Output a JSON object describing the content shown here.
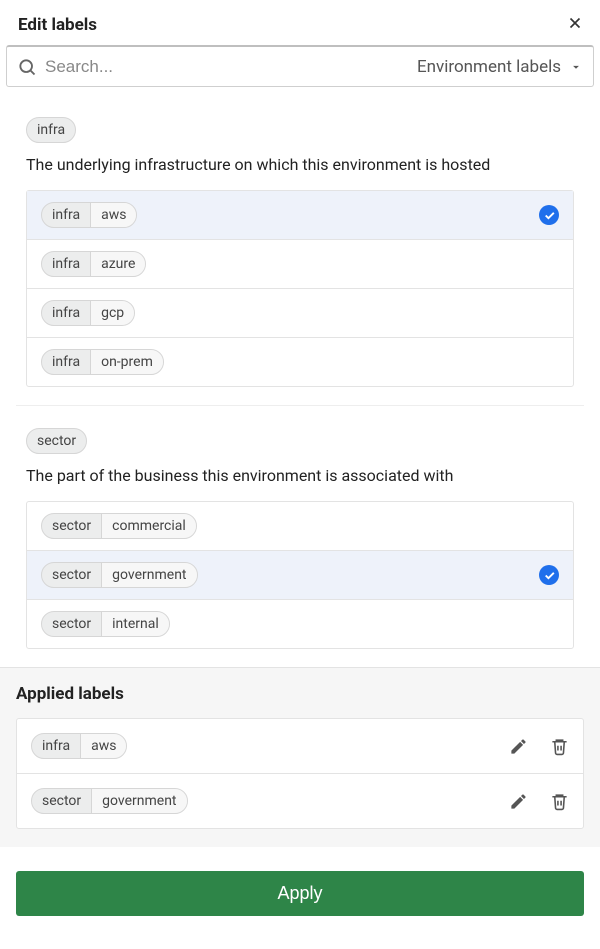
{
  "dialog": {
    "title": "Edit labels"
  },
  "search": {
    "placeholder": "Search...",
    "filter": "Environment labels"
  },
  "groups": [
    {
      "key": "infra",
      "description": "The underlying infrastructure on which this environment is hosted",
      "options": [
        {
          "key": "infra",
          "value": "aws",
          "selected": true
        },
        {
          "key": "infra",
          "value": "azure",
          "selected": false
        },
        {
          "key": "infra",
          "value": "gcp",
          "selected": false
        },
        {
          "key": "infra",
          "value": "on-prem",
          "selected": false
        }
      ]
    },
    {
      "key": "sector",
      "description": "The part of the business this environment is associated with",
      "options": [
        {
          "key": "sector",
          "value": "commercial",
          "selected": false
        },
        {
          "key": "sector",
          "value": "government",
          "selected": true
        },
        {
          "key": "sector",
          "value": "internal",
          "selected": false
        }
      ]
    }
  ],
  "applied": {
    "title": "Applied labels",
    "labels": [
      {
        "key": "infra",
        "value": "aws"
      },
      {
        "key": "sector",
        "value": "government"
      }
    ]
  },
  "footer": {
    "apply": "Apply"
  }
}
